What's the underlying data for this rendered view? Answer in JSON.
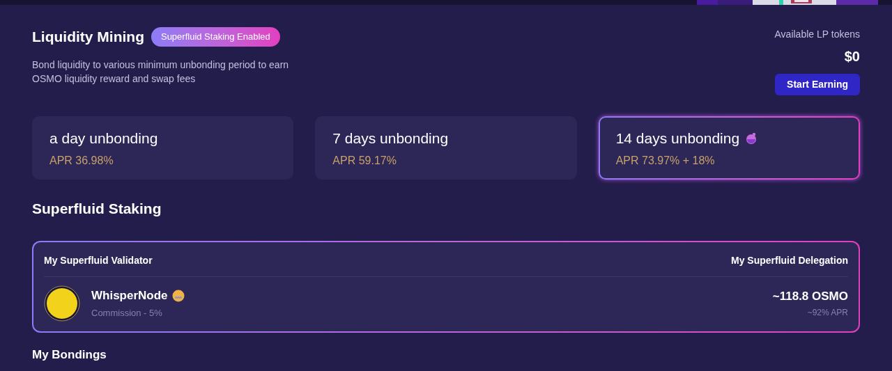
{
  "header": {
    "title": "Liquidity Mining",
    "badge": "Superfluid Staking Enabled",
    "description": "Bond liquidity to various minimum unbonding period to earn OSMO liquidity reward and swap fees",
    "available_label": "Available LP tokens",
    "available_value": "$0",
    "action": "Start Earning"
  },
  "unbonding_options": [
    {
      "title": "a day unbonding",
      "apr": "APR 36.98%",
      "selected": false,
      "superfluid": false
    },
    {
      "title": "7 days unbonding",
      "apr": "APR 59.17%",
      "selected": false,
      "superfluid": false
    },
    {
      "title": "14 days unbonding",
      "apr": "APR 73.97% + 18%",
      "selected": true,
      "superfluid": true
    }
  ],
  "superfluid": {
    "title": "Superfluid Staking",
    "validator_heading": "My Superfluid Validator",
    "delegation_heading": "My Superfluid Delegation",
    "validator_name": "WhisperNode",
    "commission": "Commission - 5%",
    "delegation_amount": "~118.8 OSMO",
    "delegation_apr": "~92% APR"
  },
  "bondings": {
    "title": "My Bondings"
  }
}
